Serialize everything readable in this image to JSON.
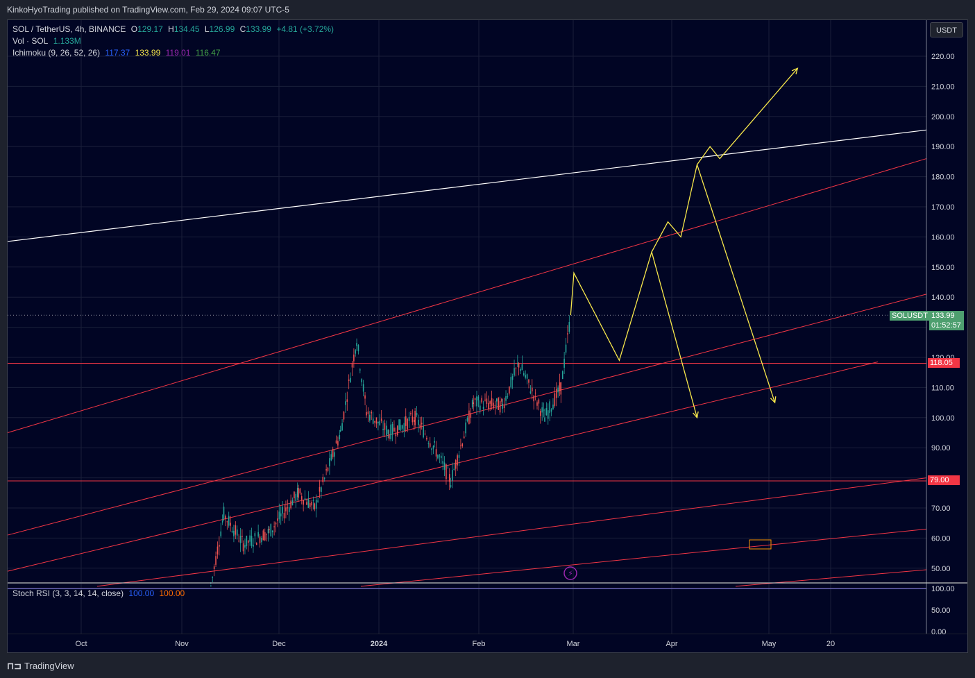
{
  "header": {
    "publisher_line": "KinkoHyoTrading published on TradingView.com, Feb 29, 2024 09:07 UTC-5"
  },
  "legend": {
    "symbol": "SOL / TetherUS, 4h, BINANCE",
    "o_label": "O",
    "o_value": "129.17",
    "h_label": "H",
    "h_value": "134.45",
    "l_label": "L",
    "l_value": "126.99",
    "c_label": "C",
    "c_value": "133.99",
    "change": "+4.81 (+3.72%)",
    "vol_label": "Vol · SOL",
    "vol_value": "1.133M",
    "ichimoku_label": "Ichimoku (9, 26, 52, 26)",
    "ichimoku_values": [
      "117.37",
      "133.99",
      "119.01",
      "116.47"
    ],
    "stoch_label": "Stoch RSI (3, 3, 14, 14, close)",
    "stoch_k": "100.00",
    "stoch_d": "100.00"
  },
  "price_axis": {
    "currency_button": "USDT",
    "ticks": [
      "220.00",
      "210.00",
      "200.00",
      "190.00",
      "180.00",
      "170.00",
      "160.00",
      "150.00",
      "140.00",
      "130.00",
      "120.00",
      "110.00",
      "100.00",
      "90.00",
      "80.00",
      "70.00",
      "60.00",
      "50.00"
    ],
    "symbol_tag": "SOLUSDT",
    "last_price": "133.99",
    "countdown": "01:52:57",
    "level_1": "118.05",
    "level_2": "79.00"
  },
  "rsi_axis": {
    "ticks": [
      "100.00",
      "50.00",
      "0.00"
    ]
  },
  "time_axis": {
    "ticks": [
      "Oct",
      "Nov",
      "Dec",
      "2024",
      "Feb",
      "Mar",
      "Apr",
      "May",
      "20"
    ]
  },
  "footer": {
    "brand": "TradingView"
  },
  "colors": {
    "background": "#010524",
    "grid": "#1a1f3a",
    "candle_up": "#26a69a",
    "candle_down": "#ef5350",
    "channel": "#f23645",
    "white_line": "#ffffff",
    "projection": "#f7e84b",
    "horizontal": "#f23645",
    "last_price": "#4e9f6f",
    "stoch_k": "#2962ff",
    "stoch_d": "#ff6d00"
  },
  "chart_data": {
    "type": "line",
    "title": "SOL / TetherUS, 4h, BINANCE",
    "price_range": [
      44,
      229
    ],
    "horizontal_levels": [
      118.05,
      79.0,
      133.99
    ],
    "price_path_approx": {
      "x": [
        "2023-11-10",
        "2023-11-14",
        "2023-11-20",
        "2023-11-28",
        "2023-12-07",
        "2023-12-12",
        "2023-12-20",
        "2023-12-25",
        "2023-12-28",
        "2024-01-04",
        "2024-01-12",
        "2024-01-18",
        "2024-01-23",
        "2024-01-30",
        "2024-02-08",
        "2024-02-13",
        "2024-02-21",
        "2024-02-26",
        "2024-02-29"
      ],
      "y": [
        44,
        68,
        58,
        62,
        75,
        70,
        95,
        126,
        102,
        95,
        100,
        90,
        79,
        105,
        104,
        118,
        100,
        110,
        134
      ]
    },
    "projection_path_1": {
      "x": [
        "2024-02-29",
        "2024-03-01",
        "2024-03-15",
        "2024-03-25",
        "2024-04-08"
      ],
      "y": [
        134,
        148,
        119,
        155,
        100
      ]
    },
    "projection_path_2": {
      "x": [
        "2024-03-25",
        "2024-03-30",
        "2024-04-03",
        "2024-04-08",
        "2024-04-12",
        "2024-04-15",
        "2024-05-09"
      ],
      "y": [
        155,
        165,
        160,
        184,
        190,
        186,
        216
      ]
    },
    "projection_path_3": {
      "x": [
        "2024-04-08",
        "2024-05-02"
      ],
      "y": [
        184,
        105
      ]
    },
    "stoch_rsi": {
      "k": 100.0,
      "d": 100.0,
      "range": [
        0,
        100
      ]
    }
  }
}
